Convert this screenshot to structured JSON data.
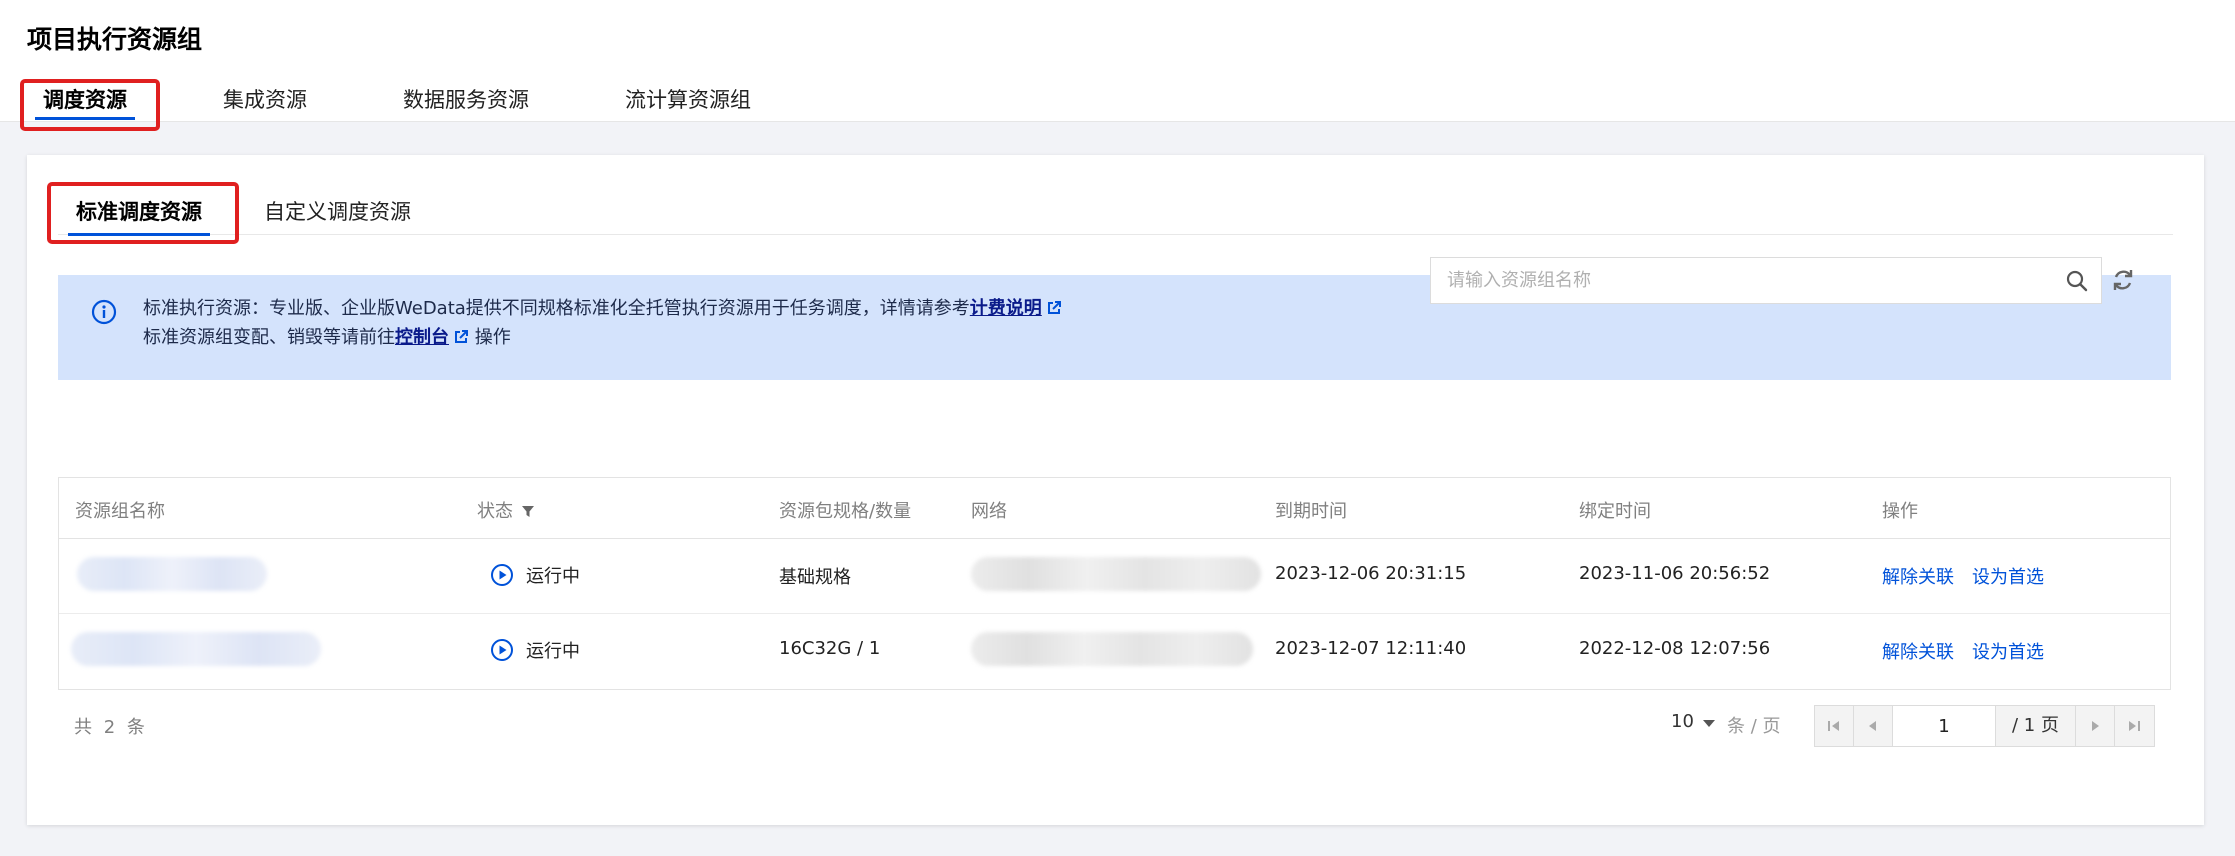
{
  "page": {
    "title": "项目执行资源组"
  },
  "top_tabs": [
    {
      "label": "调度资源",
      "active": true
    },
    {
      "label": "集成资源",
      "active": false
    },
    {
      "label": "数据服务资源",
      "active": false
    },
    {
      "label": "流计算资源组",
      "active": false
    }
  ],
  "sub_tabs": [
    {
      "label": "标准调度资源",
      "active": true
    },
    {
      "label": "自定义调度资源",
      "active": false
    }
  ],
  "notice": {
    "line1_text": "标准执行资源：专业版、企业版WeData提供不同规格标准化全托管执行资源用于任务调度，详情请参考",
    "line1_link": "计费说明",
    "line2_text": "标准资源组变配、销毁等请前往",
    "line2_link": "控制台",
    "line2_suffix": "操作"
  },
  "search": {
    "placeholder": "请输入资源组名称",
    "value": ""
  },
  "table": {
    "columns": [
      "资源组名称",
      "状态",
      "资源包规格/数量",
      "网络",
      "到期时间",
      "绑定时间",
      "操作"
    ],
    "rows": [
      {
        "status": "运行中",
        "spec": "基础规格",
        "expire": "2023-12-06 20:31:15",
        "bind": "2023-11-06 20:56:52",
        "op1": "解除关联",
        "op2": "设为首选"
      },
      {
        "status": "运行中",
        "spec": "16C32G / 1",
        "expire": "2023-12-07 12:11:40",
        "bind": "2022-12-08 12:07:56",
        "op1": "解除关联",
        "op2": "设为首选"
      }
    ]
  },
  "pagination": {
    "total_text": "共 2 条",
    "page_size": "10",
    "per_page_label": "条 / 页",
    "current_page": "1",
    "total_pages_text": "/ 1 页"
  },
  "colors": {
    "accent": "#0052d9",
    "highlight": "#e02020",
    "notice_bg": "#d4e3fc"
  }
}
